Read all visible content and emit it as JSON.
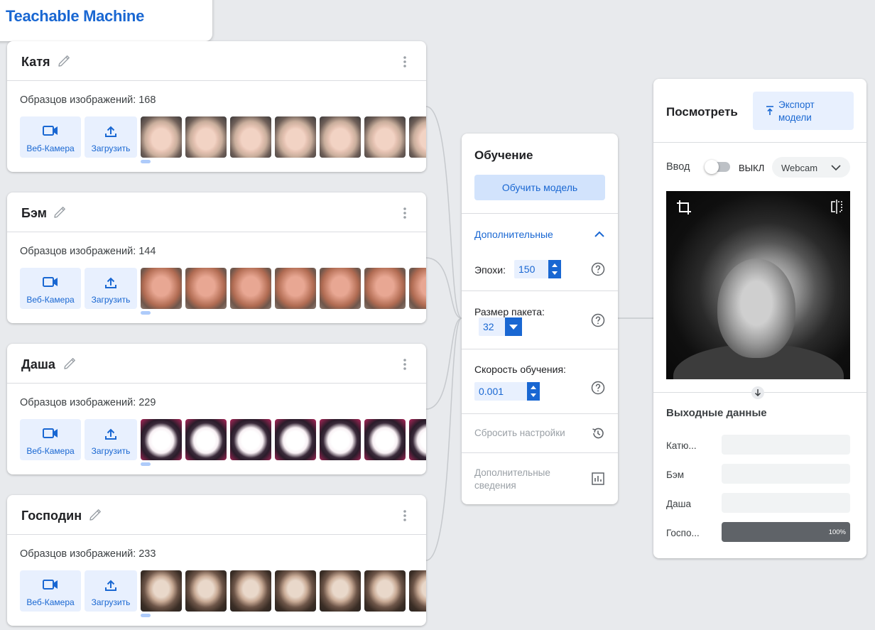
{
  "app": {
    "title": "Teachable Machine"
  },
  "classes": [
    {
      "name": "Катя",
      "samples_label": "Образцов изображений: 168",
      "webcam_label": "Веб-Камера",
      "upload_label": "Загрузить",
      "thumb_style": "face-kat"
    },
    {
      "name": "Бэм",
      "samples_label": "Образцов изображений: 144",
      "webcam_label": "Веб-Камера",
      "upload_label": "Загрузить",
      "thumb_style": "face-bem"
    },
    {
      "name": "Даша",
      "samples_label": "Образцов изображений: 229",
      "webcam_label": "Веб-Камера",
      "upload_label": "Загрузить",
      "thumb_style": "face-dash"
    },
    {
      "name": "Господин",
      "samples_label": "Образцов изображений: 233",
      "webcam_label": "Веб-Камера",
      "upload_label": "Загрузить",
      "thumb_style": "face-gos"
    }
  ],
  "training": {
    "title": "Обучение",
    "train_button": "Обучить модель",
    "advanced_label": "Дополнительные",
    "epochs_label": "Эпохи:",
    "epochs_value": "150",
    "batch_label": "Размер пакета:",
    "batch_value": "32",
    "lr_label": "Скорость обучения:",
    "lr_value": "0.001",
    "reset_label": "Сбросить настройки",
    "details_label": "Дополнительные сведения"
  },
  "preview": {
    "title": "Посмотреть",
    "export_button": "Экспорт модели",
    "input_label": "Ввод",
    "toggle_state": "ВЫКЛ",
    "source_select": "Webcam",
    "output_title": "Выходные данные",
    "outputs": [
      {
        "label": "Катю...",
        "value": 0
      },
      {
        "label": "Бэм",
        "value": 0
      },
      {
        "label": "Даша",
        "value": 0
      },
      {
        "label": "Госпо...",
        "value": 100,
        "value_text": "100%"
      }
    ]
  }
}
